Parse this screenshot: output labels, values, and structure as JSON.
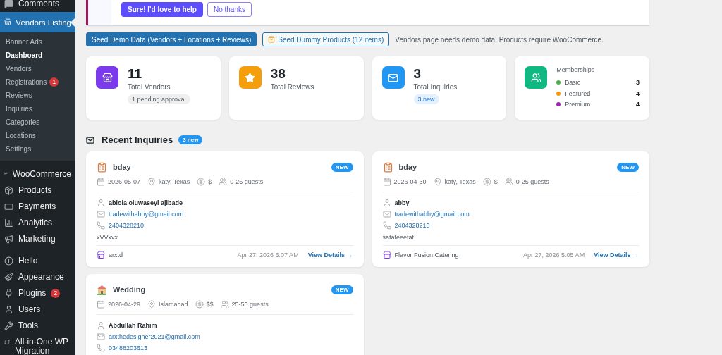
{
  "sidebar": {
    "items_before": [
      {
        "label": "Comments"
      }
    ],
    "current": {
      "label": "Vendors Listing",
      "submenu": [
        {
          "label": "Banner Ads",
          "selected": false
        },
        {
          "label": "Dashboard",
          "selected": true
        },
        {
          "label": "Vendors",
          "selected": false
        },
        {
          "label": "Registrations",
          "selected": false,
          "badge": "1"
        },
        {
          "label": "Reviews",
          "selected": false
        },
        {
          "label": "Inquiries",
          "selected": false
        },
        {
          "label": "Categories",
          "selected": false
        },
        {
          "label": "Locations",
          "selected": false
        },
        {
          "label": "Settings",
          "selected": false
        }
      ]
    },
    "items_after": [
      {
        "label": "WooCommerce"
      },
      {
        "label": "Products"
      },
      {
        "label": "Payments"
      },
      {
        "label": "Analytics"
      },
      {
        "label": "Marketing"
      },
      {
        "label": "Hello"
      },
      {
        "label": "Appearance"
      },
      {
        "label": "Plugins",
        "badge": "2"
      },
      {
        "label": "Users"
      },
      {
        "label": "Tools"
      },
      {
        "label": "All-in-One WP Migration"
      }
    ]
  },
  "notice": {
    "buttons": [
      {
        "label": "Sure! I'd love to help",
        "kind": "primary"
      },
      {
        "label": "No thanks",
        "kind": "secondary"
      }
    ]
  },
  "toolbar": {
    "buttons": [
      {
        "label": "Seed Demo Data (Vendors + Locations + Reviews)",
        "kind": "primary"
      },
      {
        "label": "Seed Dummy Products (12 items)",
        "kind": "secondary"
      }
    ],
    "note": "Vendors page needs demo data. Products require WooCommerce."
  },
  "stats": [
    {
      "kind": "count",
      "color": "#7c3aed",
      "value": "11",
      "label": "Total Vendors",
      "badge": {
        "text": "1 pending approval",
        "kind": "neutral"
      }
    },
    {
      "kind": "count",
      "color": "#f59e0b",
      "value": "38",
      "label": "Total Reviews"
    },
    {
      "kind": "count",
      "color": "#2196f3",
      "value": "3",
      "label": "Total Inquiries",
      "badge": {
        "text": "3 new",
        "kind": "info"
      }
    },
    {
      "kind": "list",
      "color": "#10b981",
      "title": "Memberships",
      "items": [
        {
          "name": "Basic",
          "color": "#4caf50",
          "count": "3"
        },
        {
          "name": "Featured",
          "color": "#ff9800",
          "count": "4"
        },
        {
          "name": "Premium",
          "color": "#9c27b0",
          "count": "4"
        }
      ]
    }
  ],
  "inquiries": {
    "title": "Recent Inquiries",
    "badge": "3 new",
    "cards": [
      {
        "title": "bday",
        "badge": "NEW",
        "date": "2026-05-07",
        "location": "katy, Texas",
        "budget": "$",
        "guests": "0-25 guests",
        "name": "abiola oluwaseyi ajibade",
        "email": "tradewithabby@gmail.com",
        "phone": "2404328210",
        "message": "xVVxvx",
        "vendor": "arxtd",
        "time": "Apr 27, 2026 5:07 AM",
        "link": "View Details →"
      },
      {
        "title": "bday",
        "badge": "NEW",
        "date": "2026-04-30",
        "location": "katy, Texas",
        "budget": "$",
        "guests": "0-25 guests",
        "name": "abby",
        "email": "tradewithabby@gmail.com",
        "phone": "2404328210",
        "message": "safafeeefaf",
        "vendor": "Flavor Fusion Catering",
        "time": "Apr 27, 2026 5:05 AM",
        "link": "View Details →"
      },
      {
        "title": "Wedding",
        "badge": "NEW",
        "date": "2026-04-29",
        "location": "Islamabad",
        "budget": "$$",
        "guests": "25-50 guests",
        "name": "Abdullah Rahim",
        "email": "arxthedesigner2021@gmail.com",
        "phone": "03488203613"
      }
    ]
  }
}
